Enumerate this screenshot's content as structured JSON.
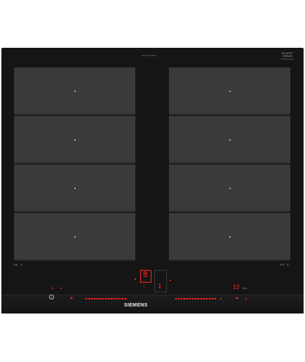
{
  "header": {
    "model_text": "EX675LXE1E",
    "glass_brand": [
      "SCHOTT",
      "CERAN"
    ],
    "glass_sub": "EX675LXE1E"
  },
  "zones": {
    "left": [
      "zone-left-1",
      "zone-left-2",
      "zone-left-3",
      "zone-left-4"
    ],
    "right": [
      "zone-right-1",
      "zone-right-2",
      "zone-right-3",
      "zone-right-4"
    ]
  },
  "labels": {
    "left_flex": "FX",
    "right_flex": "FX",
    "left_icon": "⅄",
    "right_icon": "⅄"
  },
  "display": {
    "main_digit": "8",
    "lower_digit": "0",
    "right_digit": "1",
    "timer_digits": "12",
    "timer_unit": "min"
  },
  "controls": {
    "info_symbol": "i",
    "brand": "SIEMENS"
  },
  "colors": {
    "panel": "#151515",
    "zone": "#3a3a3a",
    "accent": "#ff2a2a"
  }
}
